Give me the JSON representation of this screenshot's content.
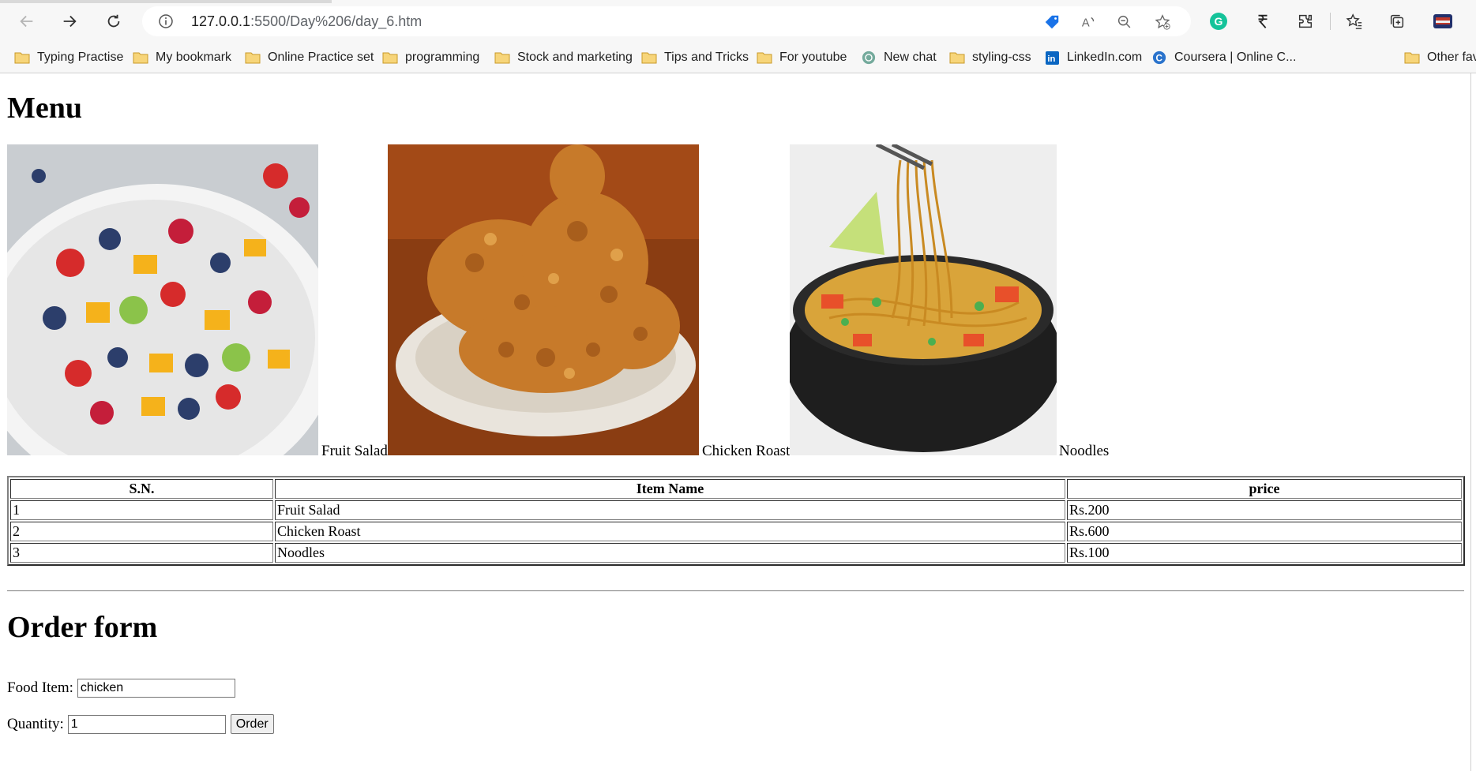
{
  "browser": {
    "url_host": "127.0.0.1",
    "url_rest": ":5500/Day%206/day_6.htm",
    "bookmarks": [
      {
        "label": "Typing Practise",
        "icon": "folder-icon"
      },
      {
        "label": "My bookmark",
        "icon": "folder-icon"
      },
      {
        "label": "Online Practice set",
        "icon": "folder-icon"
      },
      {
        "label": "programming",
        "icon": "folder-icon"
      },
      {
        "label": "Stock and marketing",
        "icon": "folder-icon"
      },
      {
        "label": "Tips and Tricks",
        "icon": "folder-icon"
      },
      {
        "label": "For youtube",
        "icon": "folder-icon"
      },
      {
        "label": "New chat",
        "icon": "chatgpt-icon"
      },
      {
        "label": "styling-css",
        "icon": "folder-icon"
      },
      {
        "label": "LinkedIn.com",
        "icon": "linkedin-icon"
      },
      {
        "label": "Coursera | Online C...",
        "icon": "coursera-icon"
      },
      {
        "label": "Other fav",
        "icon": "folder-icon"
      }
    ]
  },
  "page": {
    "menu_title": "Menu",
    "foods": [
      {
        "caption": "Fruit Salad"
      },
      {
        "caption": "Chicken Roast"
      },
      {
        "caption": "Noodles"
      }
    ],
    "table": {
      "headers": [
        "S.N.",
        "Item Name",
        "price"
      ],
      "rows": [
        [
          "1",
          "Fruit Salad",
          "Rs.200"
        ],
        [
          "2",
          "Chicken Roast",
          "Rs.600"
        ],
        [
          "3",
          "Noodles",
          "Rs.100"
        ]
      ]
    },
    "order_title": "Order form",
    "form": {
      "food_label": "Food Item:",
      "food_value": "chicken",
      "quantity_label": "Quantity:",
      "quantity_value": "1",
      "order_button": "Order"
    }
  },
  "colors": {
    "folder": "#f2c14e",
    "grammarly": "#15c39a",
    "linkedin": "#0a66c2",
    "coursera": "#2a73cc"
  }
}
